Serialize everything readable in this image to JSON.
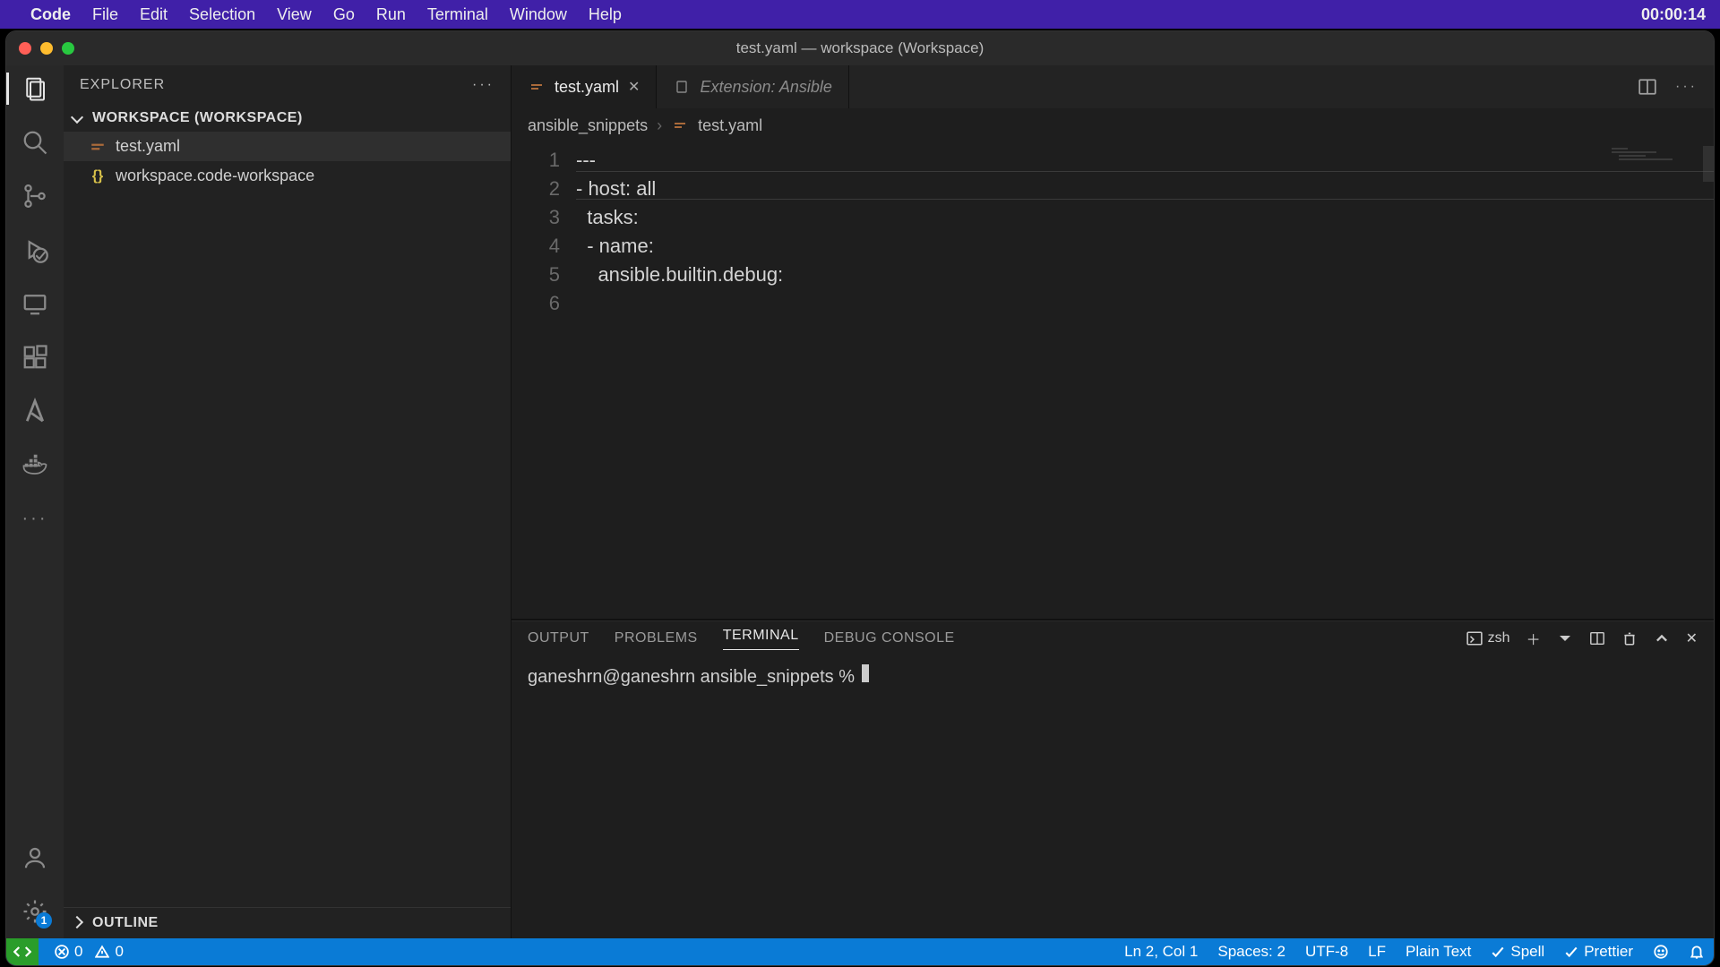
{
  "menubar": {
    "app": "Code",
    "items": [
      "File",
      "Edit",
      "Selection",
      "View",
      "Go",
      "Run",
      "Terminal",
      "Window",
      "Help"
    ],
    "clock": "00:00:14"
  },
  "window": {
    "title": "test.yaml — workspace (Workspace)"
  },
  "sidebar": {
    "title": "EXPLORER",
    "workspace_label": "WORKSPACE (WORKSPACE)",
    "files": [
      {
        "name": "test.yaml",
        "icon": "yaml",
        "selected": true
      },
      {
        "name": "workspace.code-workspace",
        "icon": "json",
        "selected": false
      }
    ],
    "outline_label": "OUTLINE"
  },
  "tabs": [
    {
      "label": "test.yaml",
      "icon": "yaml",
      "active": true,
      "dirty": false
    },
    {
      "label": "Extension: Ansible",
      "icon": "doc",
      "active": false,
      "dirty": false
    }
  ],
  "breadcrumb": [
    "ansible_snippets",
    "test.yaml"
  ],
  "editor": {
    "lines": [
      "---",
      "- host: all",
      "  tasks:",
      "  - name:",
      "    ansible.builtin.debug:",
      ""
    ],
    "highlight_line": 2
  },
  "panel": {
    "tabs": [
      "OUTPUT",
      "PROBLEMS",
      "TERMINAL",
      "DEBUG CONSOLE"
    ],
    "active": "TERMINAL",
    "shell": "zsh",
    "terminal_line": "ganeshrn@ganeshrn ansible_snippets % "
  },
  "statusbar": {
    "errors": "0",
    "warnings": "0",
    "cursor": "Ln 2, Col 1",
    "indent": "Spaces: 2",
    "encoding": "UTF-8",
    "eol": "LF",
    "language": "Plain Text",
    "spell": "Spell",
    "prettier": "Prettier"
  },
  "settings_badge": "1",
  "colors": {
    "accent": "#0a7bd6",
    "remote": "#2a9d2a",
    "menubar": "#4020a8"
  }
}
